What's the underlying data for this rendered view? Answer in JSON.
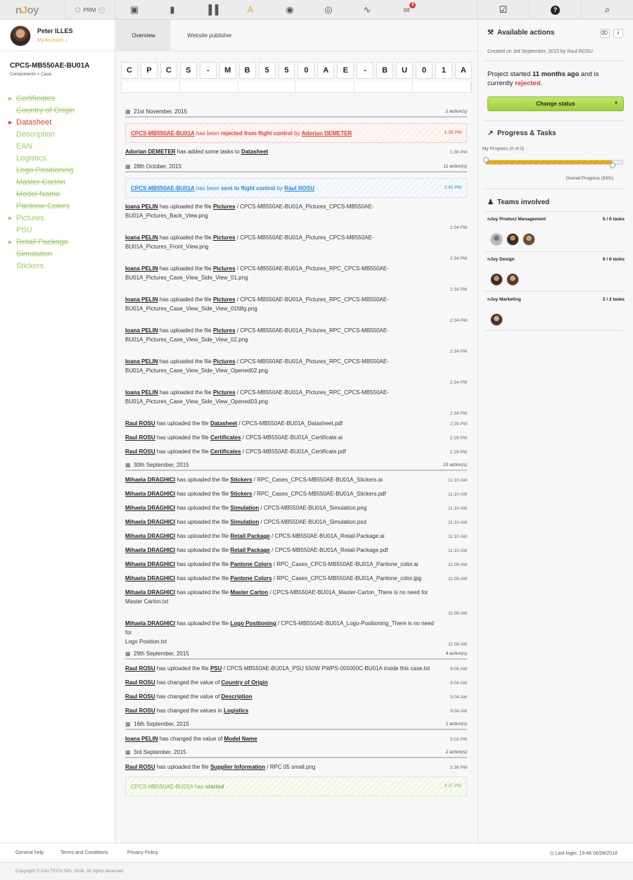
{
  "topbar": {
    "logo_a": "n",
    "logo_b": "J",
    "logo_c": "oy",
    "module": "PRM",
    "notification_count": "3",
    "icons": [
      "cube-icon",
      "tablet-icon",
      "barcode-icon",
      "font-icon",
      "broadcast-icon",
      "globe-icon",
      "pulse-icon",
      "link-icon"
    ],
    "right_icons": [
      "calendar-check-icon",
      "help-icon",
      "search-icon"
    ]
  },
  "user": {
    "name": "Peter ILLES",
    "account": "My Account"
  },
  "project": {
    "title": "CPCS-MB550AE-BU01A",
    "breadcrumb": [
      "Components",
      "Case"
    ],
    "code_chars": [
      "C",
      "P",
      "C",
      "S",
      "-",
      "M",
      "B",
      "5",
      "5",
      "0",
      "A",
      "E",
      "-",
      "B",
      "U",
      "0",
      "1",
      "A"
    ]
  },
  "nav": [
    {
      "label": "Certificates",
      "arrow": true,
      "state": "done"
    },
    {
      "label": "Country of Origin",
      "arrow": false,
      "state": "done"
    },
    {
      "label": "Datasheet",
      "arrow": true,
      "state": "rejected"
    },
    {
      "label": "Description",
      "arrow": false,
      "state": "plain"
    },
    {
      "label": "EAN",
      "arrow": false,
      "state": "plain"
    },
    {
      "label": "Logistics",
      "arrow": false,
      "state": "plain"
    },
    {
      "label": "Logo Positioning",
      "arrow": false,
      "state": "done"
    },
    {
      "label": "Master Carton",
      "arrow": false,
      "state": "done"
    },
    {
      "label": "Model Name",
      "arrow": false,
      "state": "done"
    },
    {
      "label": "Pantone Colors",
      "arrow": false,
      "state": "done"
    },
    {
      "label": "Pictures",
      "arrow": true,
      "state": "plain"
    },
    {
      "label": "PSU",
      "arrow": false,
      "state": "plain"
    },
    {
      "label": "Retail Package",
      "arrow": true,
      "state": "done"
    },
    {
      "label": "Simulation",
      "arrow": false,
      "state": "done"
    },
    {
      "label": "Stickers",
      "arrow": false,
      "state": "plain"
    }
  ],
  "tabs": {
    "overview": "Overview",
    "publisher": "Website publisher"
  },
  "feed": {
    "d1": {
      "date": "21st November, 2015",
      "count": "2 action(s)"
    },
    "rej": {
      "code": "CPCS-MB550AE-BU01A",
      "t1": " has been ",
      "action": "rejected from flight control",
      "t2": " by ",
      "user": "Adorian DEMETER",
      "time": "1:39 PM"
    },
    "e_ad": {
      "user": "Adorian DEMETER",
      "t": " has added some tasks to ",
      "item": "Datasheet",
      "time": "1:36 PM"
    },
    "d2": {
      "date": "28th October, 2015",
      "count": "11 action(s)"
    },
    "sent": {
      "code": "CPCS-MB550AE-BU01A",
      "t1": " has been ",
      "action": "sent to flight control",
      "t2": " by ",
      "user": "Raul ROSU",
      "time": "2:41 PM"
    },
    "pics": [
      {
        "file": "CPCS-MB550AE-BU01A_Pictures_CPCS-MB550AE-",
        "file2": "BU01A_Pictures_Back_View.png",
        "time": "2:34 PM"
      },
      {
        "file": "CPCS-MB550AE-BU01A_Pictures_CPCS-MB550AE-",
        "file2": "BU01A_Pictures_Front_View.png",
        "time": "2:34 PM"
      },
      {
        "file": "CPCS-MB550AE-BU01A_Pictures_RPC_CPCS-MB550AE-",
        "file2": "BU01A_Pictures_Case_View_Side_View_01.png",
        "time": "2:34 PM"
      },
      {
        "file": "CPCS-MB550AE-BU01A_Pictures_RPC_CPCS-MB550AE-",
        "file2": "BU01A_Pictures_Case_View_Side_View_01fdfg.png",
        "time": "2:34 PM"
      },
      {
        "file": "CPCS-MB550AE-BU01A_Pictures_RPC_CPCS-MB550AE-",
        "file2": "BU01A_Pictures_Case_View_Side_View_02.png",
        "time": "2:34 PM"
      },
      {
        "file": "CPCS-MB550AE-BU01A_Pictures_RPC_CPCS-MB550AE-",
        "file2": "BU01A_Pictures_Case_View_Side_View_Opened02.png",
        "time": "2:34 PM"
      },
      {
        "file": "CPCS-MB550AE-BU01A_Pictures_RPC_CPCS-MB550AE-",
        "file2": "BU01A_Pictures_Case_View_Side_View_Opened03.png",
        "time": "2:34 PM"
      }
    ],
    "pic_user": "Ioana PELIN",
    "uploaded": " has uploaded the file ",
    "pic_item": "Pictures",
    "sep": " / ",
    "raul": [
      {
        "item": "Datasheet",
        "file": "CPCS-MB550AE-BU01A_Datasheet.pdf",
        "time": "2:29 PM"
      },
      {
        "item": "Certificates",
        "file": "CPCS-MB550AE-BU01A_Certificate.ai",
        "time": "2:29 PM"
      },
      {
        "item": "Certificates",
        "file": "CPCS-MB550AE-BU01A_Certificate.pdf",
        "time": "2:29 PM"
      }
    ],
    "raul_user": "Raul ROSU",
    "d3": {
      "date": "30th September, 2015",
      "count": "10 action(s)"
    },
    "mih_user": "Mihaela DRAGHICI",
    "mih": [
      {
        "item": "Stickers",
        "file": "RPC_Cases_CPCS-MB550AE-BU01A_Stickers.ai",
        "time": "11:10 AM"
      },
      {
        "item": "Stickers",
        "file": "RPC_Cases_CPCS-MB550AE-BU01A_Stickers.pdf",
        "time": "11:10 AM"
      },
      {
        "item": "Simulation",
        "file": "CPCS-MB550AE-BU01A_Simulation.png",
        "time": "11:10 AM"
      },
      {
        "item": "Simulation",
        "file": "CPCS-MB550AE-BU01A_Simulation.psd",
        "time": "11:10 AM"
      },
      {
        "item": "Retail Package",
        "file": "CPCS-MB550AE-BU01A_Retail-Package.ai",
        "time": "11:10 AM"
      },
      {
        "item": "Retail Package",
        "file": "CPCS-MB550AE-BU01A_Retail-Package.pdf",
        "time": "11:10 AM"
      },
      {
        "item": "Pantone Colors",
        "file": "RPC_Cases_CPCS-MB550AE-BU01A_Pantone_color.ai",
        "time": "11:09 AM"
      },
      {
        "item": "Pantone Colors",
        "file": "RPC_Cases_CPCS-MB550AE-BU01A_Pantone_color.jpg",
        "time": "11:09 AM"
      }
    ],
    "mih_mc": {
      "item": "Master Carton",
      "file": "CPCS-MB550AE-BU01A_Master-Carton_There is no need for",
      "file2": "Master Carton.txt",
      "time": "11:09 AM"
    },
    "mih_lp": {
      "item": "Logo Positioning",
      "file": "CPCS-MB550AE-BU01A_Logo-Positioning_There is no need for",
      "file2": "Logo Position.txt",
      "time": "11:08 AM"
    },
    "d4": {
      "date": "29th September, 2015",
      "count": "4 action(s)"
    },
    "psu": {
      "item": "PSU",
      "file": "CPCS-MB550AE-BU01A_PSU 550W PWPS-055000C-BU01A inside this case.txt",
      "time": "9:06 AM"
    },
    "ch1": {
      "t": " has changed the value of ",
      "item": "Country of Origin",
      "time": "9:04 AM"
    },
    "ch2": {
      "t": " has changed the value of ",
      "item": "Description",
      "time": "9:04 AM"
    },
    "ch3": {
      "t": " has changed the values in ",
      "item": "Logistics",
      "time": "9:04 AM"
    },
    "d5": {
      "date": "16th September, 2015",
      "count": "1 action(s)"
    },
    "mn": {
      "t": " has changed the value of ",
      "item": "Model Name",
      "time": "3:03 PM"
    },
    "d6": {
      "date": "3rd September, 2015",
      "count": "2 action(s)"
    },
    "sup": {
      "item": "Supplier Information",
      "file": "RPC 05 small.png",
      "time": "3:38 PM"
    },
    "start": {
      "code": "CPCS-MB550AE-BU01A",
      "t": " has ",
      "action": "started",
      "time": "3:37 PM"
    }
  },
  "right": {
    "actions_title": "Available actions",
    "created": "Created on 3rd September, 2015 by Raul ROSU",
    "proj_a": "Project started ",
    "proj_b": "11 months ago",
    "proj_c": " and is currently ",
    "proj_d": "rejected",
    "proj_e": ".",
    "change_status": "Change status",
    "progress_title": "Progress & Tasks",
    "my_progress": "My Progress (0 of 0)",
    "my_progress_value": 0,
    "overall_value": 0.93,
    "overall": "Overall Progress (93%)",
    "teams_title": "Teams involved",
    "teams": [
      {
        "name": "nJoy Product Management",
        "tasks": "5 / 6 tasks"
      },
      {
        "name": "nJoy Design",
        "tasks": "6 / 6 tasks"
      },
      {
        "name": "nJoy Marketing",
        "tasks": "2 / 2 tasks"
      }
    ]
  },
  "footer": {
    "help": "General help",
    "terms": "Terms and Conditions",
    "privacy": "Privacy Policy",
    "last_login": "Last login: 19:48 06/08/2016",
    "copyright": "Copyright © DAI-TECH SRL 2016. All rights reserved."
  },
  "colors": {
    "accent": "#f0a32e",
    "rejected": "#e53935",
    "sent": "#1e88e5",
    "done": "#9ccc65",
    "button": "#a8d64a"
  }
}
